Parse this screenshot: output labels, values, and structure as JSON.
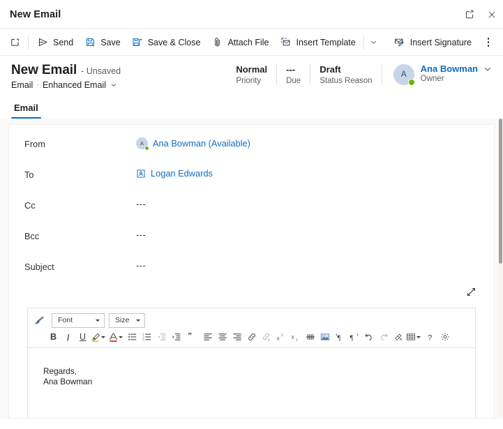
{
  "window": {
    "title": "New Email",
    "popout_icon": "popout-icon",
    "close_icon": "close-icon"
  },
  "commandbar": {
    "new_icon": "new-window-icon",
    "items": [
      {
        "label": "Send",
        "icon": "send-icon"
      },
      {
        "label": "Save",
        "icon": "save-icon"
      },
      {
        "label": "Save & Close",
        "icon": "save-and-close-icon"
      },
      {
        "label": "Attach File",
        "icon": "paperclip-icon"
      },
      {
        "label": "Insert Template",
        "icon": "insert-template-icon"
      },
      {
        "label": "Insert Signature",
        "icon": "insert-signature-icon"
      }
    ],
    "split_caret": "chevron-down-icon",
    "overflow": "more-commands-icon"
  },
  "record_header": {
    "title": "New Email",
    "unsaved": "- Unsaved",
    "entity": "Email",
    "separator": "·",
    "form_name": "Enhanced Email",
    "form_chevron": "chevron-down-icon",
    "stats": [
      {
        "value": "Normal",
        "label": "Priority"
      },
      {
        "value": "---",
        "label": "Due"
      },
      {
        "value": "Draft",
        "label": "Status Reason"
      }
    ],
    "owner": {
      "initial": "A",
      "name": "Ana Bowman",
      "role": "Owner",
      "presence": "available",
      "chevron": "chevron-down-icon"
    }
  },
  "tabs": [
    {
      "label": "Email",
      "selected": true
    }
  ],
  "form": {
    "fields": [
      {
        "label": "From",
        "type": "person",
        "initial": "A",
        "value": "Ana Bowman (Available)",
        "presence": "available"
      },
      {
        "label": "To",
        "type": "contact",
        "icon": "contact-card-icon",
        "value": "Logan Edwards"
      },
      {
        "label": "Cc",
        "type": "empty",
        "value": "---"
      },
      {
        "label": "Bcc",
        "type": "empty",
        "value": "---"
      },
      {
        "label": "Subject",
        "type": "empty",
        "value": "---"
      }
    ],
    "expand_icon": "expand-diagonal-icon"
  },
  "editor": {
    "format_painter_icon": "format-painter-icon",
    "font_select": {
      "label": "Font",
      "placeholder": "Font"
    },
    "size_select": {
      "label": "Size",
      "placeholder": "Size"
    },
    "tools": [
      {
        "name": "bold-icon",
        "glyph": "B",
        "kind": "letter",
        "style": "b",
        "disabled": false
      },
      {
        "name": "italic-icon",
        "glyph": "I",
        "kind": "letter",
        "style": "i",
        "disabled": false
      },
      {
        "name": "underline-icon",
        "glyph": "U",
        "kind": "letter",
        "style": "u",
        "disabled": false
      },
      {
        "name": "highlight-color-icon",
        "kind": "svg",
        "disabled": false,
        "caret": true
      },
      {
        "name": "font-color-icon",
        "kind": "svg",
        "disabled": false,
        "caret": true
      },
      {
        "name": "bulleted-list-icon",
        "kind": "svg",
        "disabled": false
      },
      {
        "name": "numbered-list-icon",
        "kind": "svg",
        "disabled": false
      },
      {
        "name": "decrease-indent-icon",
        "kind": "svg",
        "disabled": true
      },
      {
        "name": "increase-indent-icon",
        "kind": "svg",
        "disabled": false
      },
      {
        "name": "blockquote-icon",
        "kind": "svg",
        "disabled": false
      },
      {
        "name": "align-left-icon",
        "kind": "svg",
        "disabled": false
      },
      {
        "name": "align-center-icon",
        "kind": "svg",
        "disabled": false
      },
      {
        "name": "align-right-icon",
        "kind": "svg",
        "disabled": false
      },
      {
        "name": "insert-link-icon",
        "kind": "svg",
        "disabled": false
      },
      {
        "name": "remove-link-icon",
        "kind": "svg",
        "disabled": true
      },
      {
        "name": "superscript-icon",
        "kind": "svg",
        "disabled": false
      },
      {
        "name": "subscript-icon",
        "kind": "svg",
        "disabled": false
      },
      {
        "name": "strikethrough-icon",
        "kind": "svg",
        "disabled": false
      },
      {
        "name": "insert-image-icon",
        "kind": "svg",
        "disabled": false
      },
      {
        "name": "left-to-right-icon",
        "kind": "svg",
        "disabled": false
      },
      {
        "name": "right-to-left-icon",
        "kind": "svg",
        "disabled": false
      },
      {
        "name": "undo-icon",
        "kind": "svg",
        "disabled": false
      },
      {
        "name": "redo-icon",
        "kind": "svg",
        "disabled": true
      },
      {
        "name": "clear-formatting-icon",
        "kind": "svg",
        "disabled": false
      },
      {
        "name": "insert-table-icon",
        "kind": "svg",
        "disabled": false,
        "caret": true
      },
      {
        "name": "help-icon",
        "kind": "svg",
        "disabled": false
      },
      {
        "name": "editor-settings-icon",
        "kind": "svg",
        "disabled": false
      }
    ],
    "body_lines": [
      "Regards,",
      "Ana Bowman"
    ]
  },
  "colors": {
    "accent": "#0f6cbd",
    "canvas": "#faf9f8",
    "presence_available": "#6bb700",
    "avatar_bg": "#c7d5e8",
    "border": "#e1dfdd"
  }
}
